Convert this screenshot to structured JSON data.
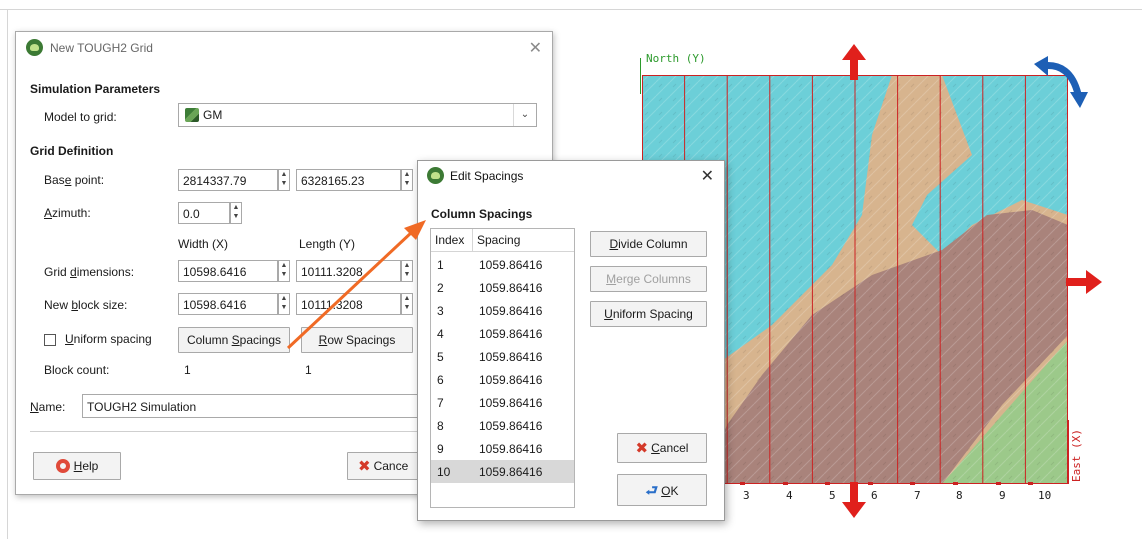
{
  "main_dialog": {
    "title": "New TOUGH2 Grid",
    "simulation_parameters": "Simulation Parameters",
    "model_to_grid_label_pre": "Model to ",
    "model_to_grid_label_u": "g",
    "model_to_grid_label_post": "rid:",
    "model_value": "GM",
    "grid_definition": "Grid Definition",
    "base_point_label_pre": "Bas",
    "base_point_label_u": "e",
    "base_point_label_post": " point:",
    "base_x": "2814337.79",
    "base_y": "6328165.23",
    "azimuth_label_u": "A",
    "azimuth_label_post": "zimuth:",
    "azimuth_value": "0.0",
    "width_header": "Width (X)",
    "length_header": "Length (Y)",
    "grid_dims_label_pre": "Grid ",
    "grid_dims_label_u": "d",
    "grid_dims_label_post": "imensions:",
    "grid_dim_width": "10598.6416",
    "grid_dim_length": "10111.3208",
    "block_size_label_pre": "New ",
    "block_size_label_u": "b",
    "block_size_label_post": "lock size:",
    "block_width": "10598.6416",
    "block_length": "10111.3208",
    "uniform_spacing_u": "U",
    "uniform_spacing_post": "niform spacing",
    "column_spacings_pre": "Column ",
    "column_spacings_u": "S",
    "column_spacings_post": "pacings",
    "row_spacings_u": "R",
    "row_spacings_post": "ow Spacings",
    "block_count_label": "Block count:",
    "block_count_x": "1",
    "block_count_y": "1",
    "name_label_u": "N",
    "name_label_post": "ame:",
    "name_value": "TOUGH2 Simulation",
    "help_u": "H",
    "help_post": "elp",
    "cancel_partial": "Cance"
  },
  "edit_spacings": {
    "title": "Edit Spacings",
    "heading": "Column Spacings",
    "col_index": "Index",
    "col_spacing": "Spacing",
    "rows": [
      {
        "index": "1",
        "spacing": "1059.86416"
      },
      {
        "index": "2",
        "spacing": "1059.86416"
      },
      {
        "index": "3",
        "spacing": "1059.86416"
      },
      {
        "index": "4",
        "spacing": "1059.86416"
      },
      {
        "index": "5",
        "spacing": "1059.86416"
      },
      {
        "index": "6",
        "spacing": "1059.86416"
      },
      {
        "index": "7",
        "spacing": "1059.86416"
      },
      {
        "index": "8",
        "spacing": "1059.86416"
      },
      {
        "index": "9",
        "spacing": "1059.86416"
      },
      {
        "index": "10",
        "spacing": "1059.86416"
      }
    ],
    "selected_row": "10",
    "divide_u": "D",
    "divide_post": "ivide Column",
    "merge_u": "M",
    "merge_post": "erge Columns",
    "uniform_u": "U",
    "uniform_post": "niform Spacing",
    "cancel_u": "C",
    "cancel_post": "ancel",
    "ok_u": "O",
    "ok_post": "K"
  },
  "map": {
    "north_label": "North (Y)",
    "east_label": "East (X)",
    "column_numbers": [
      "3",
      "4",
      "5",
      "6",
      "7",
      "8",
      "9",
      "10"
    ],
    "colors": {
      "water": "#6ccfd8",
      "sand": "#d7b48e",
      "rock": "#a9837b",
      "grass": "#9cc98a",
      "grid_line": "#cc2222",
      "arrow_red": "#e0201c",
      "arrow_blue": "#1d5fb5",
      "callout_arrow": "#f06a25"
    }
  }
}
